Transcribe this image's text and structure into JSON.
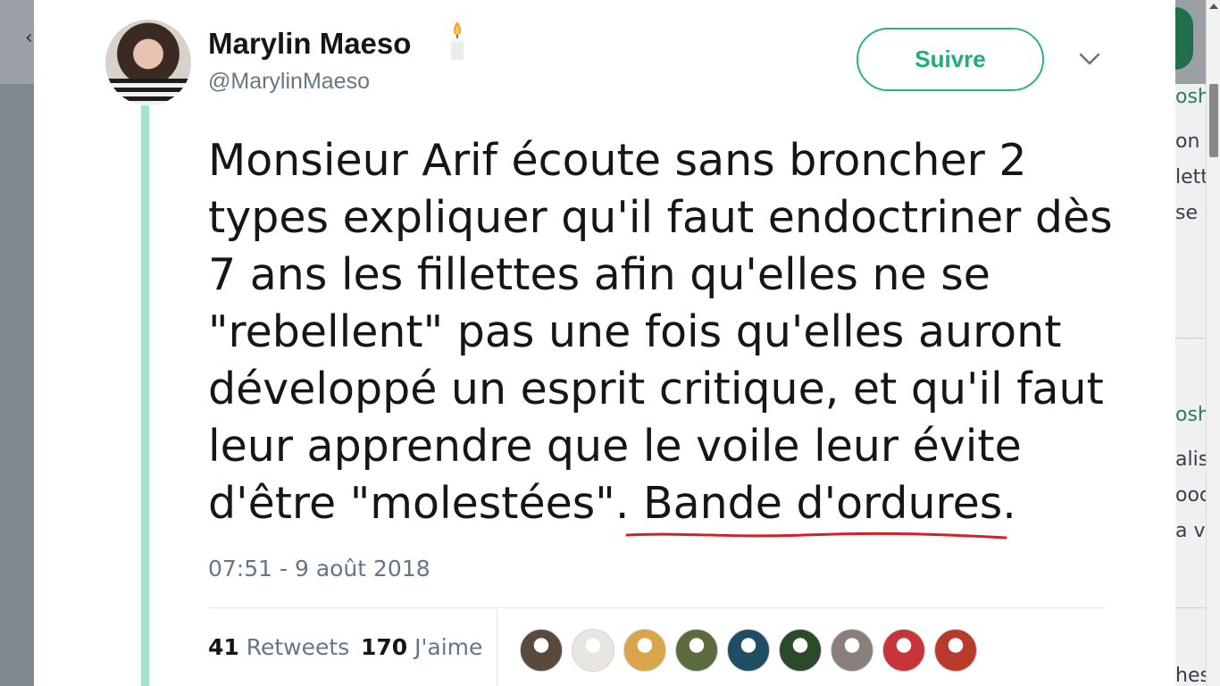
{
  "background": {
    "right_fragments": [
      {
        "text": "osh",
        "color": "green"
      },
      {
        "text": "on"
      },
      {
        "text": "lett"
      },
      {
        "text": "se"
      },
      {
        "text": "osh",
        "color": "green"
      },
      {
        "text": "alis"
      },
      {
        "text": "ooc"
      },
      {
        "text": "a v"
      },
      {
        "text": "hes"
      }
    ]
  },
  "tweet": {
    "author_name": "Marylin Maeso",
    "author_handle": "@MarylinMaeso",
    "follow_label": "Suivre",
    "text_lines": [
      "Monsieur Arif écoute sans broncher 2",
      "types expliquer qu'il faut endoctriner dès",
      "7 ans les fillettes afin qu'elles ne se",
      "\"rebellent\" pas une fois qu'elles auront",
      "développé un esprit critique, et qu'il faut",
      "leur apprendre que le voile leur évite",
      "d'être \"molestées\". Bande d'ordures."
    ],
    "timestamp": "07:51 - 9 août 2018",
    "retweets_count": "41",
    "retweets_label": "Retweets",
    "likes_count": "170",
    "likes_label": "J'aime"
  },
  "colors": {
    "accent": "#1fae7a",
    "thread_line": "#a8e3cf",
    "annotation_underline": "#d0212a",
    "secondary_text": "#657786"
  },
  "likers": [
    {
      "name": "liker-avatar-1",
      "color": "#5a4a3e"
    },
    {
      "name": "liker-avatar-2",
      "color": "#e9e6df"
    },
    {
      "name": "liker-avatar-3",
      "color": "#d9a54a"
    },
    {
      "name": "liker-avatar-4",
      "color": "#5b6b3c"
    },
    {
      "name": "liker-avatar-5",
      "color": "#1f4d63"
    },
    {
      "name": "liker-avatar-6",
      "color": "#2c4a2a"
    },
    {
      "name": "liker-avatar-7",
      "color": "#8a7f7a"
    },
    {
      "name": "liker-avatar-8",
      "color": "#c8343a"
    },
    {
      "name": "liker-avatar-9",
      "color": "#b93a2a"
    }
  ]
}
